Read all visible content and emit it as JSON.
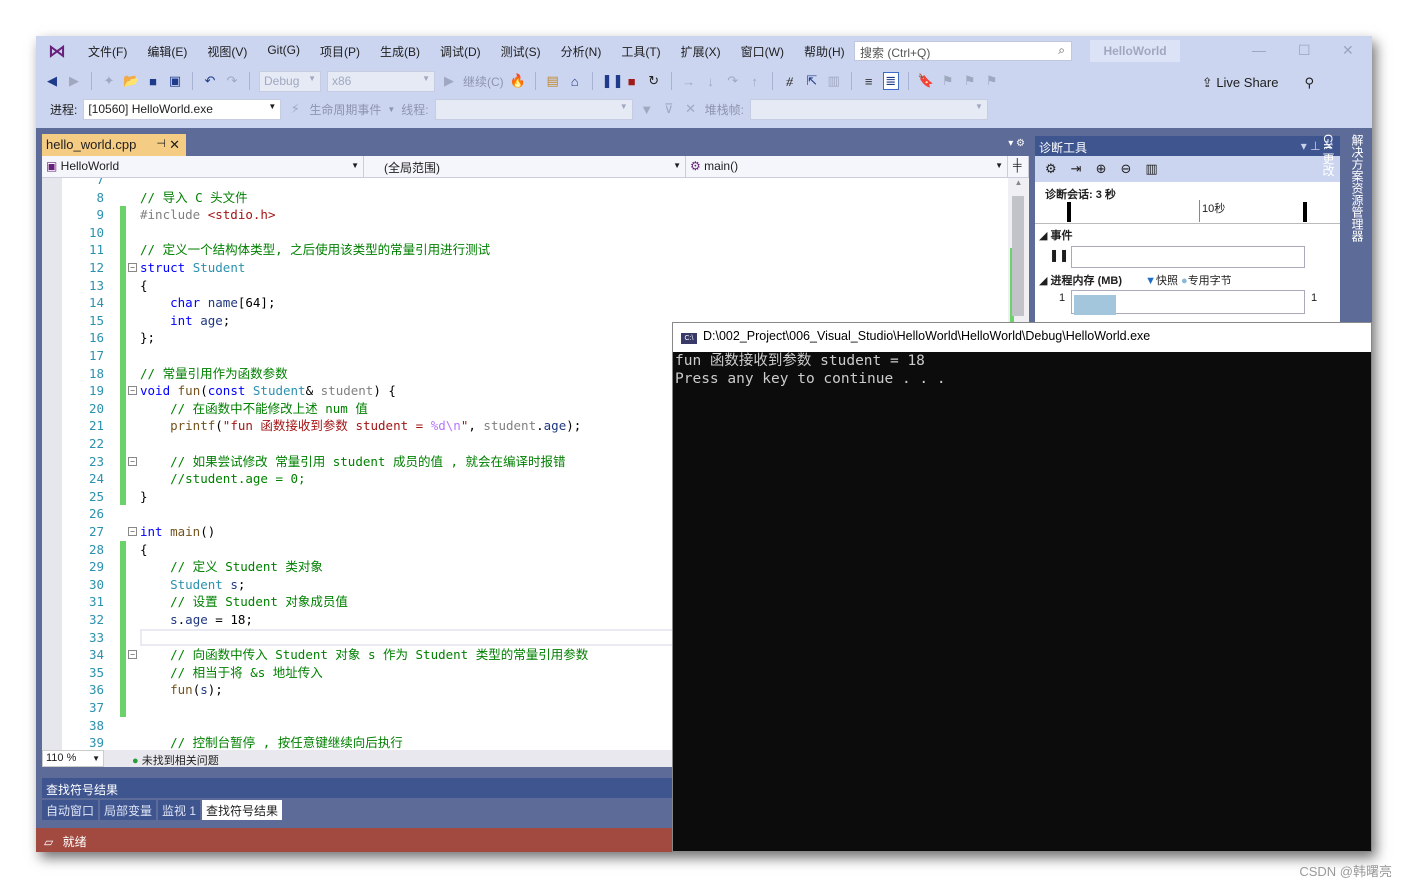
{
  "menu": {
    "items": [
      "文件(F)",
      "编辑(E)",
      "视图(V)",
      "Git(G)",
      "项目(P)",
      "生成(B)",
      "调试(D)",
      "测试(S)",
      "分析(N)",
      "工具(T)",
      "扩展(X)",
      "窗口(W)",
      "帮助(H)"
    ],
    "search_placeholder": "搜索 (Ctrl+Q)",
    "project": "HelloWorld"
  },
  "toolbar": {
    "config": "Debug",
    "platform": "x86",
    "continue": "继续(C)",
    "live_share": "Live Share",
    "process_label": "进程:",
    "process": "[10560] HelloWorld.exe",
    "lifecycle": "生命周期事件",
    "thread_label": "线程:",
    "stack_label": "堆栈帧:"
  },
  "editor": {
    "tab": "hello_world.cpp",
    "nav_project": "HelloWorld",
    "nav_scope": "(全局范围)",
    "nav_member": "main()",
    "zoom": "110 %",
    "problems": "未找到相关问题",
    "lines": [
      {
        "n": "7",
        "seg": []
      },
      {
        "n": "8",
        "seg": [
          [
            "c",
            "// 导入 C 头文件"
          ]
        ]
      },
      {
        "n": "9",
        "chg": 1,
        "seg": [
          [
            "p",
            "#include "
          ],
          [
            "s",
            "<stdio.h>"
          ]
        ]
      },
      {
        "n": "10",
        "chg": 1,
        "seg": []
      },
      {
        "n": "11",
        "chg": 1,
        "seg": [
          [
            "c",
            "// 定义一个结构体类型, 之后使用该类型的常量引用进行测试"
          ]
        ]
      },
      {
        "n": "12",
        "chg": 1,
        "fold": 1,
        "seg": [
          [
            "k",
            "struct "
          ],
          [
            "t",
            "Student"
          ]
        ]
      },
      {
        "n": "13",
        "chg": 1,
        "seg": [
          [
            "n",
            "{"
          ]
        ]
      },
      {
        "n": "14",
        "chg": 1,
        "seg": [
          [
            "n",
            "    "
          ],
          [
            "k",
            "char "
          ],
          [
            "v",
            "name"
          ],
          [
            "n",
            "[64];"
          ]
        ]
      },
      {
        "n": "15",
        "chg": 1,
        "seg": [
          [
            "n",
            "    "
          ],
          [
            "k",
            "int "
          ],
          [
            "v",
            "age"
          ],
          [
            "n",
            ";"
          ]
        ]
      },
      {
        "n": "16",
        "chg": 1,
        "seg": [
          [
            "n",
            "};"
          ]
        ]
      },
      {
        "n": "17",
        "chg": 1,
        "seg": []
      },
      {
        "n": "18",
        "chg": 1,
        "seg": [
          [
            "c",
            "// 常量引用作为函数参数"
          ]
        ]
      },
      {
        "n": "19",
        "chg": 1,
        "fold": 1,
        "seg": [
          [
            "k",
            "void "
          ],
          [
            "f",
            "fun"
          ],
          [
            "n",
            "("
          ],
          [
            "k",
            "const "
          ],
          [
            "t",
            "Student"
          ],
          [
            "n",
            "& "
          ],
          [
            "p",
            "student"
          ],
          [
            "n",
            ") {"
          ]
        ]
      },
      {
        "n": "20",
        "chg": 1,
        "seg": [
          [
            "n",
            "    "
          ],
          [
            "c",
            "// 在函数中不能修改上述 num 值"
          ]
        ]
      },
      {
        "n": "21",
        "chg": 1,
        "seg": [
          [
            "n",
            "    "
          ],
          [
            "f",
            "printf"
          ],
          [
            "n",
            "("
          ],
          [
            "s",
            "\"fun 函数接收到参数 student = "
          ],
          [
            "e",
            "%d\\n"
          ],
          [
            "s",
            "\""
          ],
          [
            "n",
            ", "
          ],
          [
            "p",
            "student"
          ],
          [
            "n",
            "."
          ],
          [
            "v",
            "age"
          ],
          [
            "n",
            ");"
          ]
        ]
      },
      {
        "n": "22",
        "chg": 1,
        "seg": []
      },
      {
        "n": "23",
        "chg": 1,
        "fold": 1,
        "seg": [
          [
            "n",
            "    "
          ],
          [
            "c",
            "// 如果尝试修改 常量引用 student 成员的值 , 就会在编译时报错"
          ]
        ]
      },
      {
        "n": "24",
        "chg": 1,
        "seg": [
          [
            "n",
            "    "
          ],
          [
            "c",
            "//student.age = 0;"
          ]
        ]
      },
      {
        "n": "25",
        "chg": 1,
        "seg": [
          [
            "n",
            "}"
          ]
        ]
      },
      {
        "n": "26",
        "seg": []
      },
      {
        "n": "27",
        "fold": 1,
        "seg": [
          [
            "k",
            "int "
          ],
          [
            "f",
            "main"
          ],
          [
            "n",
            "()"
          ]
        ]
      },
      {
        "n": "28",
        "chg": 1,
        "seg": [
          [
            "n",
            "{"
          ]
        ]
      },
      {
        "n": "29",
        "chg": 1,
        "seg": [
          [
            "n",
            "    "
          ],
          [
            "c",
            "// 定义 Student 类对象"
          ]
        ]
      },
      {
        "n": "30",
        "chg": 1,
        "seg": [
          [
            "n",
            "    "
          ],
          [
            "t",
            "Student "
          ],
          [
            "v",
            "s"
          ],
          [
            "n",
            ";"
          ]
        ]
      },
      {
        "n": "31",
        "chg": 1,
        "seg": [
          [
            "n",
            "    "
          ],
          [
            "c",
            "// 设置 Student 对象成员值"
          ]
        ]
      },
      {
        "n": "32",
        "chg": 1,
        "seg": [
          [
            "n",
            "    "
          ],
          [
            "v",
            "s"
          ],
          [
            "n",
            "."
          ],
          [
            "v",
            "age"
          ],
          [
            "n",
            " = 18;"
          ]
        ]
      },
      {
        "n": "33",
        "chg": 1,
        "cur": 1,
        "seg": []
      },
      {
        "n": "34",
        "chg": 1,
        "fold": 1,
        "seg": [
          [
            "n",
            "    "
          ],
          [
            "c",
            "// 向函数中传入 Student 对象 s 作为 Student 类型的常量引用参数"
          ]
        ]
      },
      {
        "n": "35",
        "chg": 1,
        "seg": [
          [
            "n",
            "    "
          ],
          [
            "c",
            "// 相当于将 &s 地址传入"
          ]
        ]
      },
      {
        "n": "36",
        "chg": 1,
        "seg": [
          [
            "n",
            "    "
          ],
          [
            "f",
            "fun"
          ],
          [
            "n",
            "("
          ],
          [
            "v",
            "s"
          ],
          [
            "n",
            ");"
          ]
        ]
      },
      {
        "n": "37",
        "chg": 1,
        "seg": []
      },
      {
        "n": "38",
        "seg": []
      },
      {
        "n": "39",
        "seg": [
          [
            "n",
            "    "
          ],
          [
            "c",
            "// 控制台暂停 , 按任意键继续向后执行"
          ]
        ]
      }
    ]
  },
  "diag": {
    "title": "诊断工具",
    "session": "诊断会话: 3 秒",
    "ruler_label": "10秒",
    "events": "事件",
    "memory": "进程内存 (MB)",
    "snapshot": "快照",
    "private_bytes": "专用字节",
    "mem_left": "1",
    "mem_right": "1"
  },
  "side_tabs": [
    "解决方案资源管理器",
    "Git 更改"
  ],
  "bottom": {
    "title": "查找符号结果",
    "tabs": [
      "自动窗口",
      "局部变量",
      "监视 1",
      "查找符号结果"
    ],
    "active_tab": 3
  },
  "status": {
    "text": "就绪"
  },
  "console": {
    "title": "D:\\002_Project\\006_Visual_Studio\\HelloWorld\\HelloWorld\\Debug\\HelloWorld.exe",
    "lines": [
      "fun 函数接收到参数 student = 18",
      "Press any key to continue . . ."
    ]
  },
  "watermark": "CSDN @韩曙亮",
  "colors": {
    "accent": "#68217a",
    "status_bar": "#a34a40",
    "chrome": "#ccd5f0",
    "panel": "#5d6b99",
    "tab_active": "#f5cc84"
  }
}
